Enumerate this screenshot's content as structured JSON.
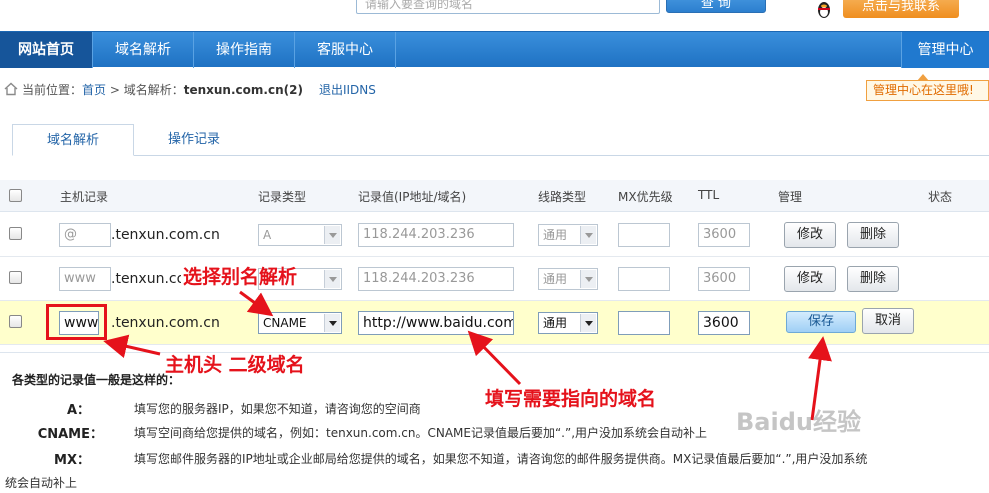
{
  "top": {
    "search_placeholder": "请输入要查询的域名",
    "search_button": "查 询",
    "contact_button": "点击与我联系"
  },
  "nav": {
    "items": [
      "网站首页",
      "域名解析",
      "操作指南",
      "客服中心"
    ],
    "right": "管理中心"
  },
  "breadcrumb": {
    "prefix": "当前位置：",
    "home": "首页",
    "sep": " > ",
    "current_label": "域名解析：",
    "current_domain": "tenxun.com.cn(2)",
    "exit": "退出IIDNS"
  },
  "manage_tip": "管理中心在这里哦!",
  "tabs": [
    "域名解析",
    "操作记录"
  ],
  "table": {
    "headers": [
      "主机记录",
      "记录类型",
      "记录值(IP地址/域名)",
      "线路类型",
      "MX优先级",
      "TTL",
      "管理",
      "状态"
    ],
    "domain_suffix": ".tenxun.com.cn",
    "rows": [
      {
        "host": "@",
        "type": "A",
        "value": "118.244.203.236",
        "line": "通用",
        "mx": "",
        "ttl": "3600",
        "btn1": "修改",
        "btn2": "删除"
      },
      {
        "host": "www",
        "type": "",
        "value": "118.244.203.236",
        "line": "通用",
        "mx": "",
        "ttl": "3600",
        "btn1": "修改",
        "btn2": "删除"
      },
      {
        "host": "www",
        "type": "CNAME",
        "value": "http://www.baidu.com",
        "line": "通用",
        "mx": "",
        "ttl": "3600",
        "btn1": "保存",
        "btn2": "取消"
      }
    ]
  },
  "info": {
    "title": "各类型的记录值一般是这样的：",
    "items": [
      {
        "key": "A：",
        "text": "填写您的服务器IP，如果您不知道，请咨询您的空间商"
      },
      {
        "key": "CNAME：",
        "text": "填写空间商给您提供的域名，例如：tenxun.com.cn。CNAME记录值最后要加“.”,用户没加系统会自动补上"
      },
      {
        "key": "MX：",
        "text": "填写您邮件服务器的IP地址或企业邮局给您提供的域名，如果您不知道，请咨询您的邮件服务提供商。MX记录值最后要加“.”,用户没加系统"
      },
      {
        "key": "",
        "text": "统会自动补上"
      }
    ]
  },
  "annotations": {
    "select_cname": "选择别名解析",
    "host_label": "主机头 二级域名",
    "fill_domain": "填写需要指向的域名"
  },
  "watermark": "Baidu经验"
}
